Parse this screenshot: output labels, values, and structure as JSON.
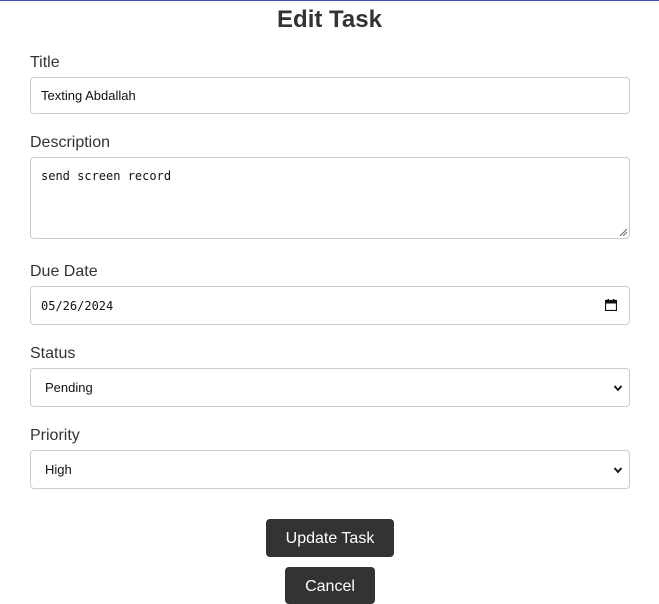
{
  "page": {
    "title": "Edit Task"
  },
  "form": {
    "title_label": "Title",
    "title_value": "Texting Abdallah",
    "description_label": "Description",
    "description_value": "send screen record",
    "due_date_label": "Due Date",
    "due_date_value": "05/26/2024",
    "status_label": "Status",
    "status_value": "Pending",
    "priority_label": "Priority",
    "priority_value": "High"
  },
  "actions": {
    "update_label": "Update Task",
    "cancel_label": "Cancel"
  },
  "icons": {
    "date": "calendar-icon",
    "select": "chevron-down-icon",
    "textarea": "resize-grip-icon"
  },
  "colors": {
    "accent_line": "#3f51b5",
    "button_bg": "#333333",
    "button_text": "#ffffff",
    "border": "#cccccc"
  }
}
